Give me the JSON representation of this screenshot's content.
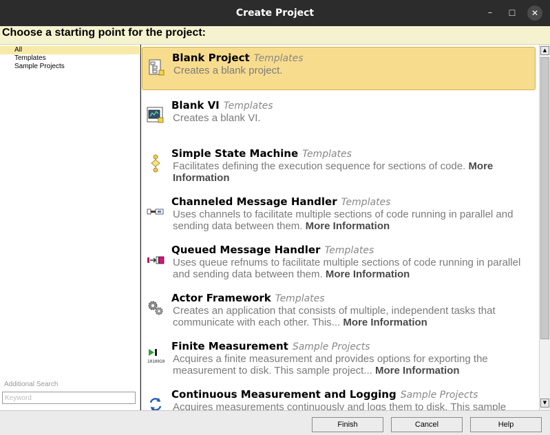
{
  "window": {
    "title": "Create Project",
    "controls": {
      "minimize": "–",
      "maximize": "☐",
      "close": "✕"
    }
  },
  "header": {
    "text": "Choose a starting point for the project:"
  },
  "categories": [
    {
      "label": "All",
      "selected": true
    },
    {
      "label": "Templates",
      "selected": false
    },
    {
      "label": "Sample Projects",
      "selected": false
    }
  ],
  "additional_search": {
    "label": "Additional Search",
    "placeholder": "Keyword"
  },
  "items": [
    {
      "name": "Blank Project",
      "tag": "Templates",
      "desc": "Creates a blank project.",
      "more": "",
      "icon": "project-icon",
      "selected": true
    },
    {
      "name": "Blank VI",
      "tag": "Templates",
      "desc": "Creates a blank VI.",
      "more": "",
      "icon": "vi-icon",
      "selected": false
    },
    {
      "name": "Simple State Machine",
      "tag": "Templates",
      "desc": "Facilitates defining the execution sequence for sections of code.",
      "more": "More Information",
      "icon": "state-machine-icon",
      "selected": false
    },
    {
      "name": "Channeled Message Handler",
      "tag": "Templates",
      "desc": "Uses channels to facilitate multiple sections of code running in parallel and sending data between them.",
      "more": "More Information",
      "icon": "channel-icon",
      "selected": false
    },
    {
      "name": "Queued Message Handler",
      "tag": "Templates",
      "desc": "Uses queue refnums to facilitate multiple sections of code running in parallel and sending data between them.",
      "more": "More Information",
      "icon": "queue-icon",
      "selected": false
    },
    {
      "name": "Actor Framework",
      "tag": "Templates",
      "desc": "Creates an application that consists of multiple, independent tasks that communicate with each other. This...",
      "more": "More Information",
      "icon": "gears-icon",
      "selected": false
    },
    {
      "name": "Finite Measurement",
      "tag": "Sample Projects",
      "desc": "Acquires a finite measurement and provides options for exporting the measurement to disk. This sample project...",
      "more": "More Information",
      "icon": "finite-measurement-icon",
      "selected": false
    },
    {
      "name": "Continuous Measurement and Logging",
      "tag": "Sample Projects",
      "desc": "Acquires measurements continuously and logs them to disk. This sample",
      "more": "",
      "icon": "continuous-measurement-icon",
      "selected": false
    }
  ],
  "buttons": {
    "finish": "Finish",
    "cancel": "Cancel",
    "help": "Help"
  },
  "colors": {
    "selection": "#f8dc8e",
    "header_bg": "#f5f2d0",
    "titlebar": "#2c2c2c"
  }
}
